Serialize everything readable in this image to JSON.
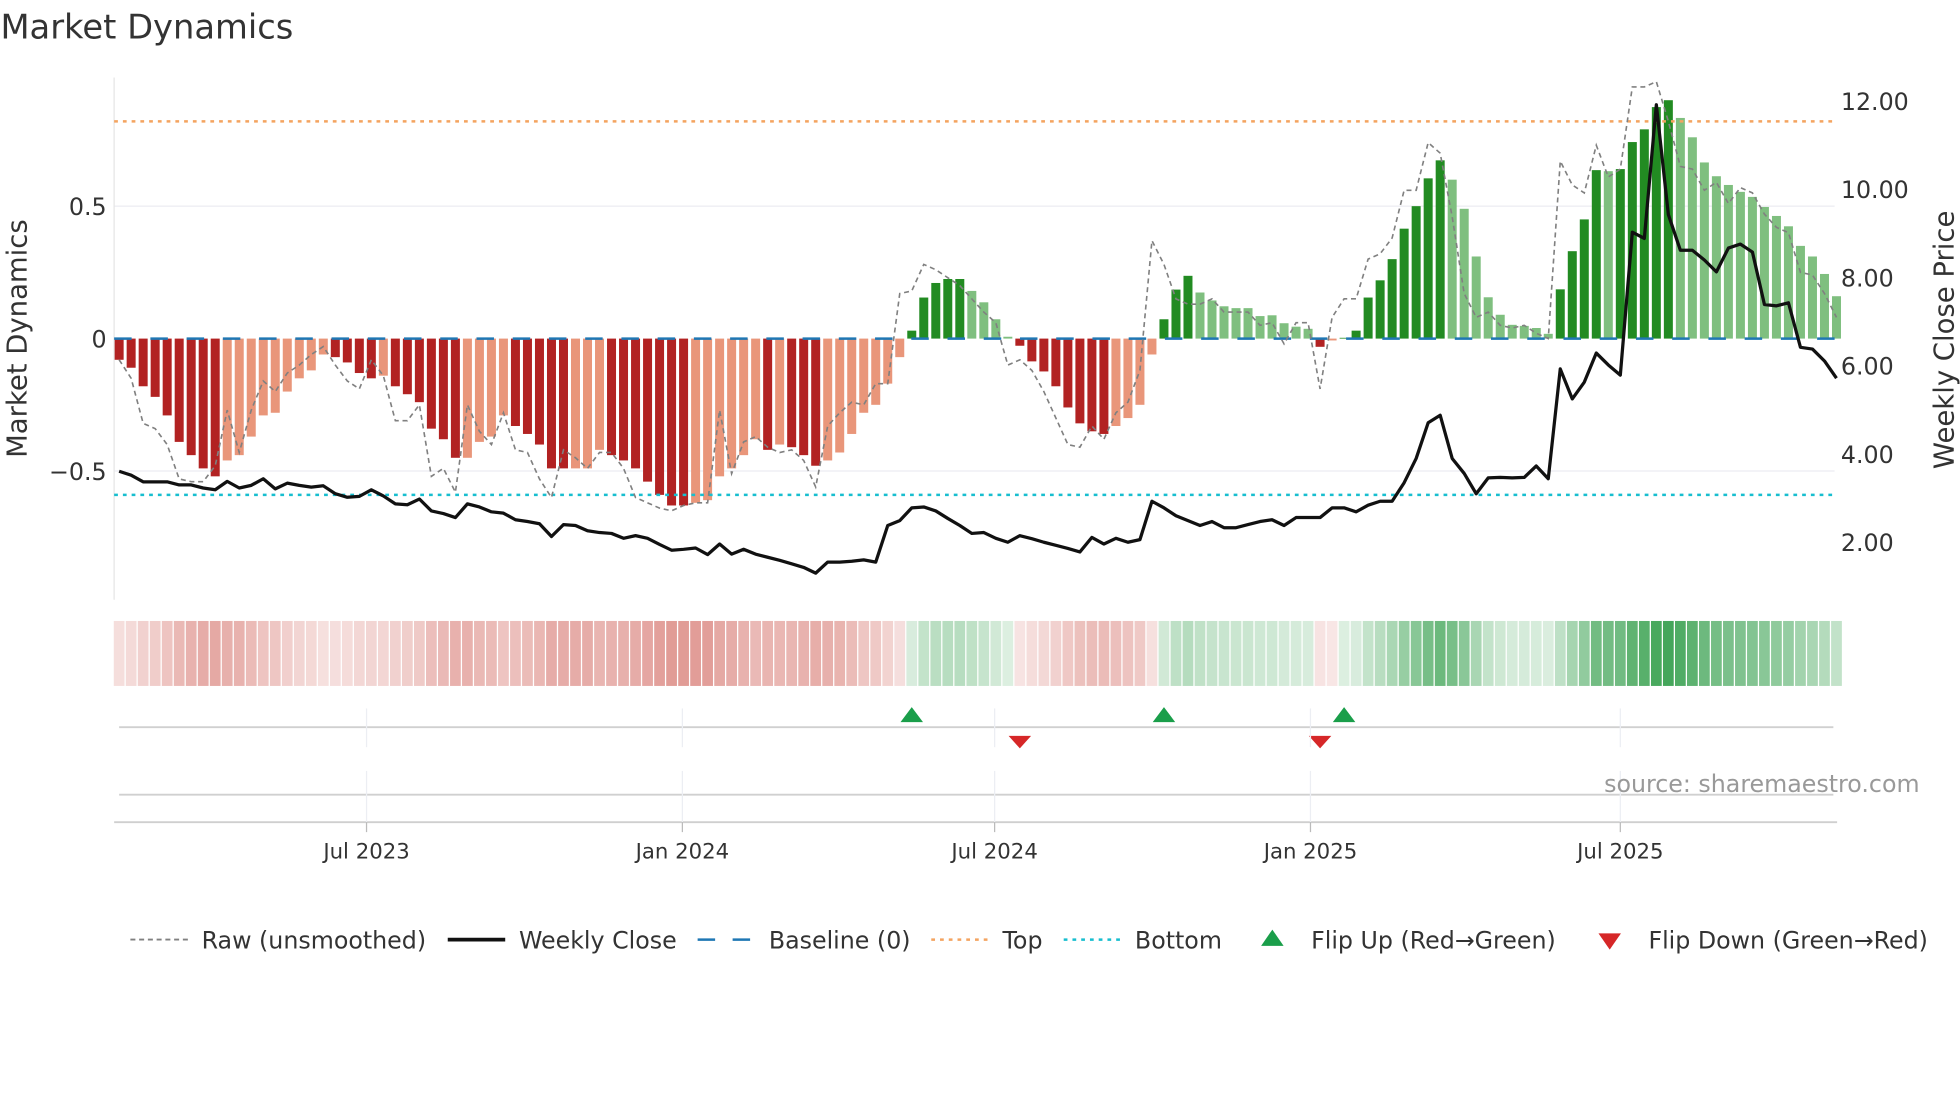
{
  "title": "Market Dynamics",
  "source": "source: sharemaestro.com",
  "colors": {
    "dark_red": "#b22222",
    "light_red": "#e9967a",
    "dark_green": "#228b22",
    "light_green": "#7fbf7f",
    "baseline": "#1f77b4",
    "top": "#f4a460",
    "bottom": "#17becf",
    "raw": "#808080",
    "close": "#111111",
    "flip_up": "#1a9e4a",
    "flip_down": "#d62728"
  },
  "chart_data": {
    "type": "bar",
    "title": "Market Dynamics",
    "ylabel": "Market Dynamics",
    "y2label": "Weekly Close Price",
    "ylim": [
      -0.98,
      1.0
    ],
    "y2lim": [
      0.7,
      12.5
    ],
    "yticks": [
      {
        "v": 0.5,
        "label": "0.5"
      },
      {
        "v": 0,
        "label": "0"
      },
      {
        "v": -0.5,
        "label": "−0.5"
      }
    ],
    "y2ticks": [
      {
        "v": 12,
        "label": "12.00"
      },
      {
        "v": 10,
        "label": "10.00"
      },
      {
        "v": 8,
        "label": "8.00"
      },
      {
        "v": 6,
        "label": "6.00"
      },
      {
        "v": 4,
        "label": "4.00"
      },
      {
        "v": 2,
        "label": "2.00"
      }
    ],
    "xticks": [
      {
        "week": 20.6,
        "label": "Jul 2023"
      },
      {
        "week": 46.9,
        "label": "Jan 2024"
      },
      {
        "week": 72.9,
        "label": "Jul 2024"
      },
      {
        "week": 99.2,
        "label": "Jan 2025"
      },
      {
        "week": 125,
        "label": "Jul 2025"
      }
    ],
    "top_level": 0.82,
    "bottom_level": -0.59,
    "baseline": 0,
    "values": [
      -0.08,
      -0.11,
      -0.18,
      -0.22,
      -0.29,
      -0.39,
      -0.44,
      -0.49,
      -0.52,
      -0.46,
      -0.44,
      -0.37,
      -0.29,
      -0.28,
      -0.2,
      -0.15,
      -0.12,
      -0.06,
      -0.07,
      -0.09,
      -0.13,
      -0.15,
      -0.14,
      -0.18,
      -0.21,
      -0.24,
      -0.34,
      -0.38,
      -0.45,
      -0.45,
      -0.39,
      -0.37,
      -0.29,
      -0.33,
      -0.36,
      -0.4,
      -0.49,
      -0.49,
      -0.49,
      -0.49,
      -0.42,
      -0.44,
      -0.46,
      -0.49,
      -0.54,
      -0.59,
      -0.63,
      -0.63,
      -0.62,
      -0.61,
      -0.52,
      -0.49,
      -0.44,
      -0.38,
      -0.42,
      -0.4,
      -0.41,
      -0.44,
      -0.48,
      -0.46,
      -0.43,
      -0.36,
      -0.28,
      -0.25,
      -0.17,
      -0.07,
      0.03,
      0.155,
      0.21,
      0.225,
      0.225,
      0.18,
      0.137,
      0.073,
      0.007,
      -0.027,
      -0.086,
      -0.124,
      -0.18,
      -0.26,
      -0.32,
      -0.35,
      -0.36,
      -0.33,
      -0.3,
      -0.25,
      -0.06,
      0.073,
      0.185,
      0.237,
      0.174,
      0.144,
      0.122,
      0.115,
      0.115,
      0.085,
      0.088,
      0.058,
      0.045,
      0.037,
      -0.031,
      -0.007,
      0.003,
      0.03,
      0.155,
      0.22,
      0.3,
      0.415,
      0.5,
      0.605,
      0.673,
      0.6,
      0.49,
      0.31,
      0.156,
      0.09,
      0.052,
      0.048,
      0.04,
      0.018,
      0.186,
      0.33,
      0.45,
      0.636,
      0.632,
      0.64,
      0.742,
      0.79,
      0.874,
      0.9,
      0.833,
      0.76,
      0.665,
      0.613,
      0.58,
      0.554,
      0.535,
      0.497,
      0.463,
      0.424,
      0.35,
      0.31,
      0.244,
      0.16
    ],
    "strength": "DDDDDDDDDLLLLLLLLLDDDDLDDDDDDLLLLDDDDDLLLDDDDDDDLLLLLLDLDDDLLLLLLLDDDDDLLLLDDDDDDDDLLLLDDDLLLLLLLLLLDLDDDDDDDDDLLLLLLLLLDDDDLDDDDDLLLLLLLLLLLLLL",
    "raw": [
      -0.08,
      -0.15,
      -0.32,
      -0.34,
      -0.4,
      -0.53,
      -0.54,
      -0.54,
      -0.48,
      -0.27,
      -0.43,
      -0.27,
      -0.16,
      -0.2,
      -0.13,
      -0.1,
      -0.06,
      -0.03,
      -0.1,
      -0.16,
      -0.19,
      -0.08,
      -0.14,
      -0.31,
      -0.31,
      -0.25,
      -0.52,
      -0.49,
      -0.58,
      -0.25,
      -0.35,
      -0.4,
      -0.28,
      -0.42,
      -0.43,
      -0.53,
      -0.6,
      -0.42,
      -0.45,
      -0.49,
      -0.43,
      -0.43,
      -0.49,
      -0.6,
      -0.62,
      -0.64,
      -0.65,
      -0.63,
      -0.62,
      -0.62,
      -0.27,
      -0.51,
      -0.39,
      -0.37,
      -0.41,
      -0.43,
      -0.42,
      -0.46,
      -0.56,
      -0.33,
      -0.28,
      -0.24,
      -0.25,
      -0.17,
      -0.17,
      0.17,
      0.18,
      0.28,
      0.26,
      0.23,
      0.2,
      0.15,
      0.1,
      0.06,
      -0.1,
      -0.08,
      -0.12,
      -0.2,
      -0.3,
      -0.4,
      -0.41,
      -0.33,
      -0.38,
      -0.28,
      -0.24,
      -0.12,
      0.37,
      0.28,
      0.15,
      0.13,
      0.13,
      0.15,
      0.1,
      0.1,
      0.1,
      0.05,
      0.06,
      -0.02,
      0.06,
      0.06,
      -0.19,
      0.08,
      0.15,
      0.15,
      0.3,
      0.32,
      0.38,
      0.56,
      0.56,
      0.74,
      0.7,
      0.46,
      0.17,
      0.08,
      0.1,
      0.05,
      0.04,
      0.05,
      0.02,
      0.0,
      0.67,
      0.58,
      0.55,
      0.73,
      0.61,
      0.64,
      0.95,
      0.95,
      0.97,
      0.82,
      0.65,
      0.64,
      0.56,
      0.59,
      0.51,
      0.57,
      0.55,
      0.47,
      0.42,
      0.4,
      0.25,
      0.24,
      0.17,
      0.08
    ],
    "close": [
      3.61,
      3.52,
      3.37,
      3.37,
      3.37,
      3.3,
      3.3,
      3.23,
      3.19,
      3.38,
      3.23,
      3.29,
      3.44,
      3.21,
      3.34,
      3.29,
      3.25,
      3.28,
      3.1,
      3.02,
      3.04,
      3.19,
      3.05,
      2.87,
      2.85,
      2.98,
      2.71,
      2.65,
      2.56,
      2.87,
      2.8,
      2.69,
      2.66,
      2.51,
      2.47,
      2.42,
      2.13,
      2.4,
      2.38,
      2.26,
      2.22,
      2.2,
      2.09,
      2.15,
      2.09,
      1.95,
      1.82,
      1.84,
      1.87,
      1.72,
      1.96,
      1.73,
      1.84,
      1.73,
      1.66,
      1.59,
      1.51,
      1.43,
      1.3,
      1.55,
      1.55,
      1.57,
      1.6,
      1.55,
      2.38,
      2.49,
      2.78,
      2.8,
      2.71,
      2.54,
      2.38,
      2.2,
      2.22,
      2.09,
      2.0,
      2.15,
      2.08,
      2.0,
      1.93,
      1.86,
      1.78,
      2.11,
      1.96,
      2.09,
      2.0,
      2.06,
      2.93,
      2.78,
      2.6,
      2.49,
      2.38,
      2.47,
      2.33,
      2.33,
      2.4,
      2.47,
      2.51,
      2.38,
      2.56,
      2.56,
      2.56,
      2.78,
      2.78,
      2.69,
      2.84,
      2.93,
      2.93,
      3.35,
      3.9,
      4.71,
      4.88,
      3.9,
      3.56,
      3.1,
      3.46,
      3.47,
      3.46,
      3.47,
      3.73,
      3.44,
      5.93,
      5.25,
      5.63,
      6.29,
      6.02,
      5.79,
      9.03,
      8.89,
      11.92,
      9.43,
      8.62,
      8.62,
      8.4,
      8.13,
      8.67,
      8.76,
      8.58,
      7.39,
      7.36,
      7.43,
      6.42,
      6.38,
      6.11,
      5.72
    ],
    "flip_up_weeks": [
      66,
      87,
      102
    ],
    "flip_down_weeks": [
      75,
      100
    ],
    "legend": {
      "placement": "bottom",
      "items": [
        {
          "key": "raw",
          "label": "Raw (unsmoothed)"
        },
        {
          "key": "close",
          "label": "Weekly Close"
        },
        {
          "key": "baseline",
          "label": "Baseline (0)"
        },
        {
          "key": "top",
          "label": "Top"
        },
        {
          "key": "bottom",
          "label": "Bottom"
        },
        {
          "key": "flip_up",
          "label": "Flip Up (Red→Green)"
        },
        {
          "key": "flip_down",
          "label": "Flip Down (Green→Red)"
        }
      ]
    }
  }
}
